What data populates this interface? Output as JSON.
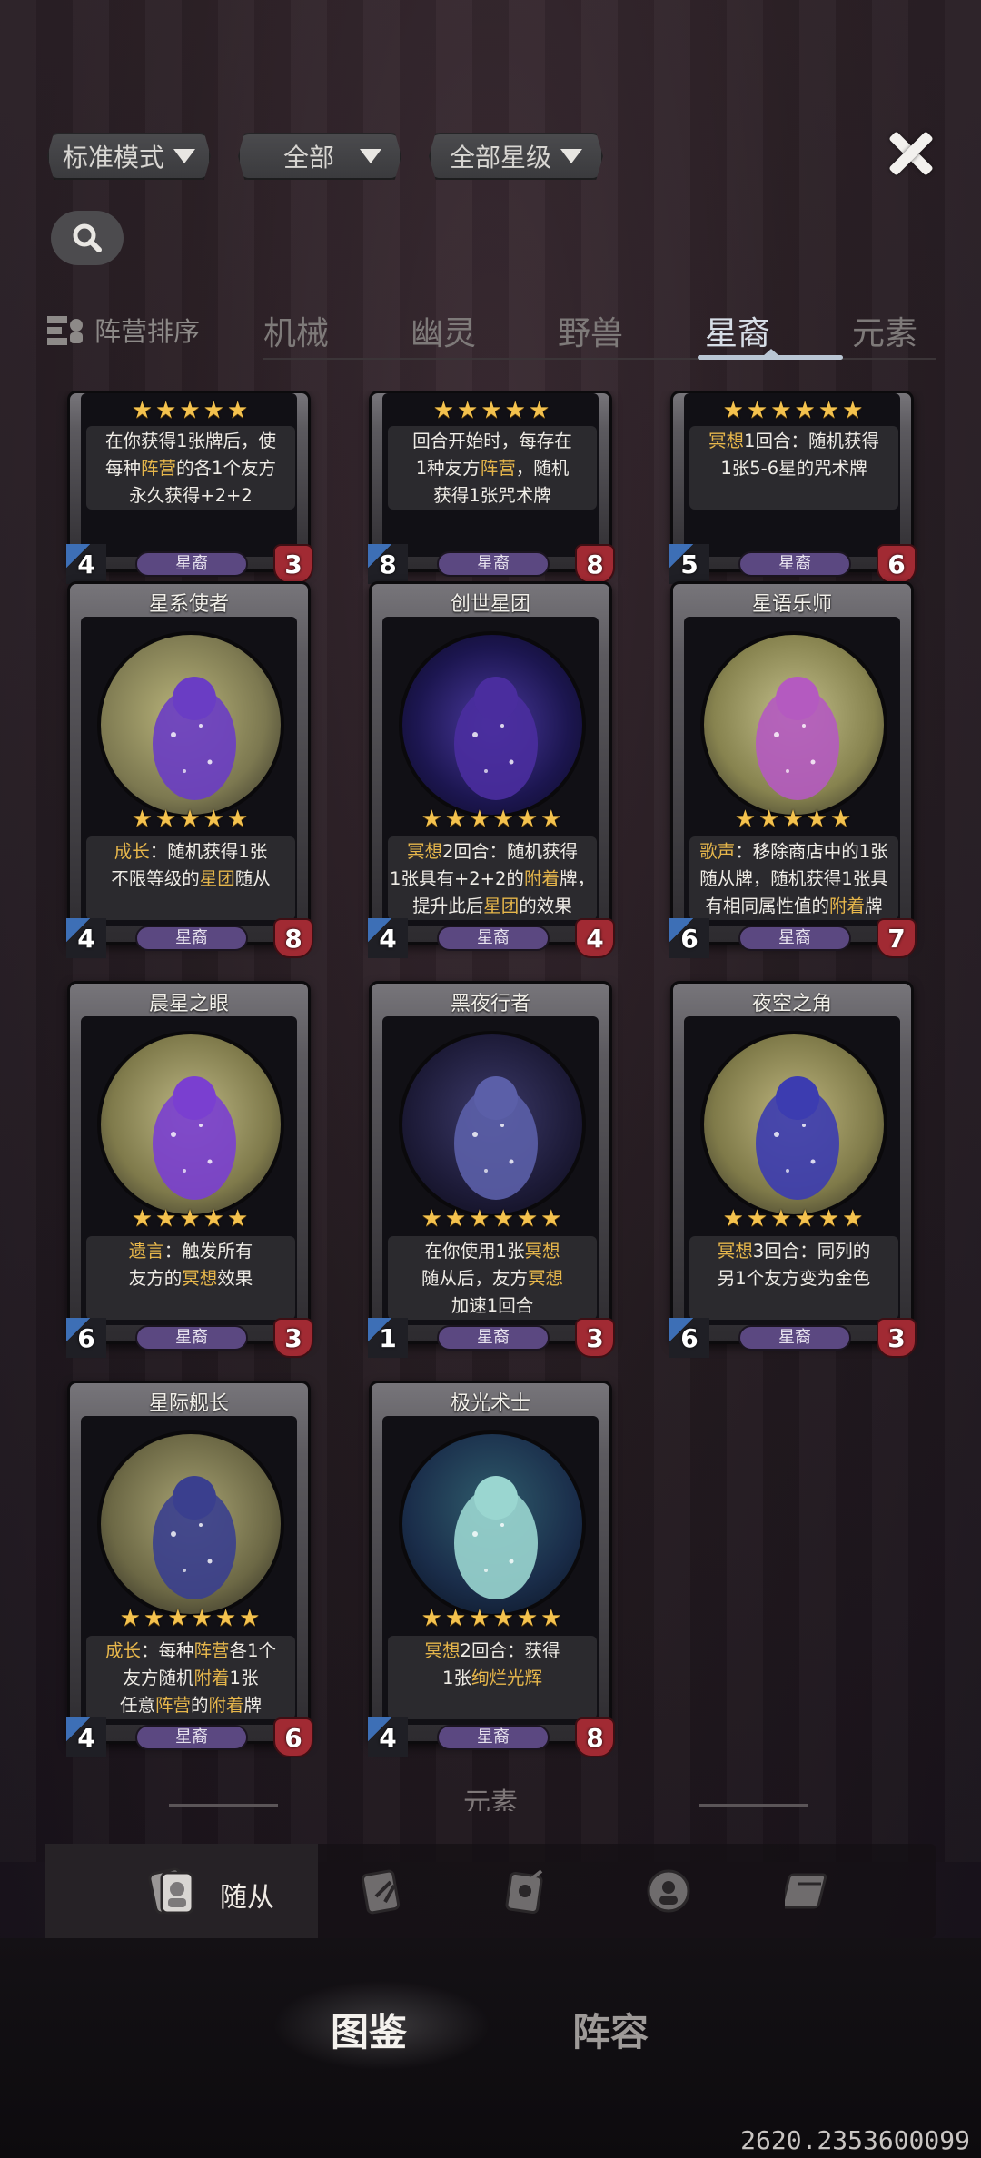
{
  "filters": [
    {
      "label": "标准模式"
    },
    {
      "label": "全部"
    },
    {
      "label": "全部星级"
    }
  ],
  "tabs": {
    "sort_label": "阵营排序",
    "items": [
      "机械",
      "幽灵",
      "野兽",
      "星裔",
      "元素"
    ],
    "active": "星裔"
  },
  "colors": {
    "accent": "#b9c6d4",
    "faction_pill": "#5b4881",
    "keyword": "#e6b64b",
    "star": "#f4c24e"
  },
  "cards": [
    {
      "name": "",
      "stars": 5,
      "desc_lines": [
        [
          {
            "t": "在你获得1张牌后，使"
          }
        ],
        [
          {
            "t": "每种"
          },
          {
            "t": "阵营",
            "k": true
          },
          {
            "t": "的各1个友方"
          }
        ],
        [
          {
            "t": "永久获得+2+2"
          }
        ]
      ],
      "cost": "4",
      "attack": "3",
      "faction": "星裔"
    },
    {
      "name": "",
      "stars": 5,
      "desc_lines": [
        [
          {
            "t": "回合开始时，每存在"
          }
        ],
        [
          {
            "t": "1种友方"
          },
          {
            "t": "阵营",
            "k": true
          },
          {
            "t": "，随机"
          }
        ],
        [
          {
            "t": "获得1张咒术牌"
          }
        ]
      ],
      "cost": "8",
      "attack": "8",
      "faction": "星裔"
    },
    {
      "name": "",
      "stars": 6,
      "desc_lines": [
        [
          {
            "t": "冥想",
            "k": true
          },
          {
            "t": "1回合：随机获得"
          }
        ],
        [
          {
            "t": "1张5-6星的咒术牌"
          }
        ]
      ],
      "cost": "5",
      "attack": "6",
      "faction": "星裔"
    },
    {
      "name": "星系使者",
      "stars": 5,
      "desc_lines": [
        [
          {
            "t": "成长",
            "k": true
          },
          {
            "t": "：随机获得1张"
          }
        ],
        [
          {
            "t": "不限等级的"
          },
          {
            "t": "星团",
            "k": true
          },
          {
            "t": "随从"
          }
        ]
      ],
      "cost": "4",
      "attack": "8",
      "faction": "星裔"
    },
    {
      "name": "创世星团",
      "stars": 6,
      "desc_lines": [
        [
          {
            "t": "冥想",
            "k": true
          },
          {
            "t": "2回合：随机获得"
          }
        ],
        [
          {
            "t": "1张具有+2+2的"
          },
          {
            "t": "附着",
            "k": true
          },
          {
            "t": "牌，"
          }
        ],
        [
          {
            "t": "提升此后"
          },
          {
            "t": "星团",
            "k": true
          },
          {
            "t": "的效果"
          }
        ]
      ],
      "cost": "4",
      "attack": "4",
      "faction": "星裔"
    },
    {
      "name": "星语乐师",
      "stars": 5,
      "desc_lines": [
        [
          {
            "t": "歌声",
            "k": true
          },
          {
            "t": "：移除商店中的1张"
          }
        ],
        [
          {
            "t": "随从牌，随机获得1张具"
          }
        ],
        [
          {
            "t": "有相同属性值的"
          },
          {
            "t": "附着",
            "k": true
          },
          {
            "t": "牌"
          }
        ]
      ],
      "cost": "6",
      "attack": "7",
      "faction": "星裔"
    },
    {
      "name": "晨星之眼",
      "stars": 5,
      "desc_lines": [
        [
          {
            "t": "遗言",
            "k": true
          },
          {
            "t": "：触发所有"
          }
        ],
        [
          {
            "t": "友方的"
          },
          {
            "t": "冥想",
            "k": true
          },
          {
            "t": "效果"
          }
        ]
      ],
      "cost": "6",
      "attack": "3",
      "faction": "星裔"
    },
    {
      "name": "黑夜行者",
      "stars": 6,
      "desc_lines": [
        [
          {
            "t": "在你使用1张"
          },
          {
            "t": "冥想",
            "k": true
          }
        ],
        [
          {
            "t": "随从后，友方"
          },
          {
            "t": "冥想",
            "k": true
          }
        ],
        [
          {
            "t": "加速1回合"
          }
        ]
      ],
      "cost": "1",
      "attack": "3",
      "faction": "星裔"
    },
    {
      "name": "夜空之角",
      "stars": 6,
      "desc_lines": [
        [
          {
            "t": "冥想",
            "k": true
          },
          {
            "t": "3回合：同列的"
          }
        ],
        [
          {
            "t": "另1个友方变为金色"
          }
        ]
      ],
      "cost": "6",
      "attack": "3",
      "faction": "星裔"
    },
    {
      "name": "星际舰长",
      "stars": 6,
      "desc_lines": [
        [
          {
            "t": "成长",
            "k": true
          },
          {
            "t": "：每种"
          },
          {
            "t": "阵营",
            "k": true
          },
          {
            "t": "各1个"
          }
        ],
        [
          {
            "t": "友方随机"
          },
          {
            "t": "附着",
            "k": true
          },
          {
            "t": "1张"
          }
        ],
        [
          {
            "t": "任意"
          },
          {
            "t": "阵营",
            "k": true
          },
          {
            "t": "的"
          },
          {
            "t": "附着",
            "k": true
          },
          {
            "t": "牌"
          }
        ]
      ],
      "cost": "4",
      "attack": "6",
      "faction": "星裔"
    },
    {
      "name": "极光术士",
      "stars": 6,
      "desc_lines": [
        [
          {
            "t": "冥想",
            "k": true
          },
          {
            "t": "2回合：获得"
          }
        ],
        [
          {
            "t": "1张"
          },
          {
            "t": "绚烂光辉",
            "k": true
          }
        ]
      ],
      "cost": "4",
      "attack": "8",
      "faction": "星裔"
    }
  ],
  "section_hint": "元素",
  "category_bar": {
    "active_label": "随从",
    "icons": [
      "minion-icon",
      "spell-card-icon",
      "attachment-card-icon",
      "hero-icon",
      "card-book-icon"
    ]
  },
  "bottom_nav": {
    "left": "图鉴",
    "right": "阵容"
  },
  "watermark": "2620.2353600099"
}
